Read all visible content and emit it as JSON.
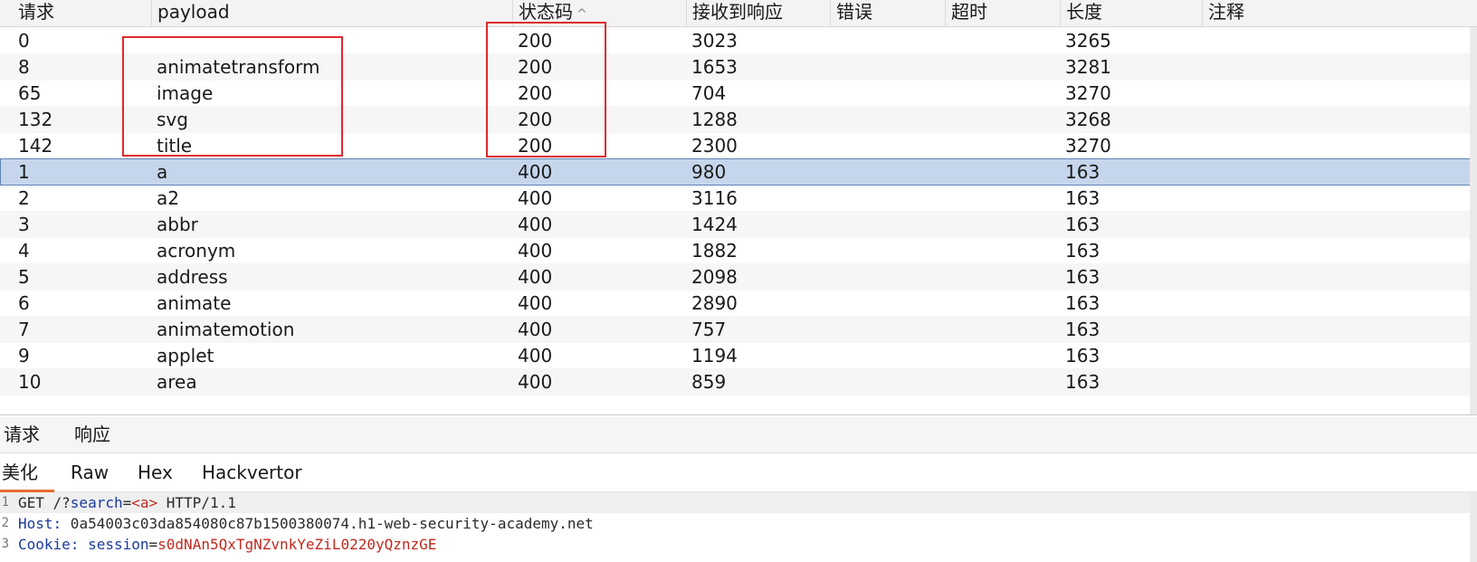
{
  "table": {
    "columns": [
      "请求",
      "payload",
      "状态码",
      "接收到响应",
      "错误",
      "超时",
      "长度",
      "注释"
    ],
    "sort_indicator": "^",
    "rows": [
      {
        "req": "0",
        "payload": "",
        "status": "200",
        "resp": "3023",
        "len": "3265"
      },
      {
        "req": "8",
        "payload": "animatetransform",
        "status": "200",
        "resp": "1653",
        "len": "3281"
      },
      {
        "req": "65",
        "payload": "image",
        "status": "200",
        "resp": "704",
        "len": "3270"
      },
      {
        "req": "132",
        "payload": "svg",
        "status": "200",
        "resp": "1288",
        "len": "3268"
      },
      {
        "req": "142",
        "payload": "title",
        "status": "200",
        "resp": "2300",
        "len": "3270"
      },
      {
        "req": "1",
        "payload": "a",
        "status": "400",
        "resp": "980",
        "len": "163"
      },
      {
        "req": "2",
        "payload": "a2",
        "status": "400",
        "resp": "3116",
        "len": "163"
      },
      {
        "req": "3",
        "payload": "abbr",
        "status": "400",
        "resp": "1424",
        "len": "163"
      },
      {
        "req": "4",
        "payload": "acronym",
        "status": "400",
        "resp": "1882",
        "len": "163"
      },
      {
        "req": "5",
        "payload": "address",
        "status": "400",
        "resp": "2098",
        "len": "163"
      },
      {
        "req": "6",
        "payload": "animate",
        "status": "400",
        "resp": "2890",
        "len": "163"
      },
      {
        "req": "7",
        "payload": "animatemotion",
        "status": "400",
        "resp": "757",
        "len": "163"
      },
      {
        "req": "9",
        "payload": "applet",
        "status": "400",
        "resp": "1194",
        "len": "163"
      },
      {
        "req": "10",
        "payload": "area",
        "status": "400",
        "resp": "859",
        "len": "163"
      }
    ],
    "selected_index": 5
  },
  "reqres_tabs": [
    "请求",
    "响应"
  ],
  "view_tabs": [
    "美化",
    "Raw",
    "Hex",
    "Hackvertor"
  ],
  "editor": {
    "line_numbers": [
      "1",
      "2",
      "3"
    ],
    "line1": {
      "method": "GET /?",
      "param": "search",
      "eq": "=",
      "value": "<a>",
      "rest": " HTTP/1.1"
    },
    "line2": {
      "key": "Host:",
      "value": " 0a54003c03da854080c87b1500380074.h1-web-security-academy.net"
    },
    "line3": {
      "key": "Cookie:",
      "sp": " ",
      "name": "session",
      "eq": "=",
      "value": "s0dNAn5QxTgNZvnkYeZiL0220yQznzGE"
    }
  },
  "colors": {
    "highlight": "#e0292b",
    "selected_row": "#c5d6ec",
    "active_tab": "#e86a2e"
  }
}
